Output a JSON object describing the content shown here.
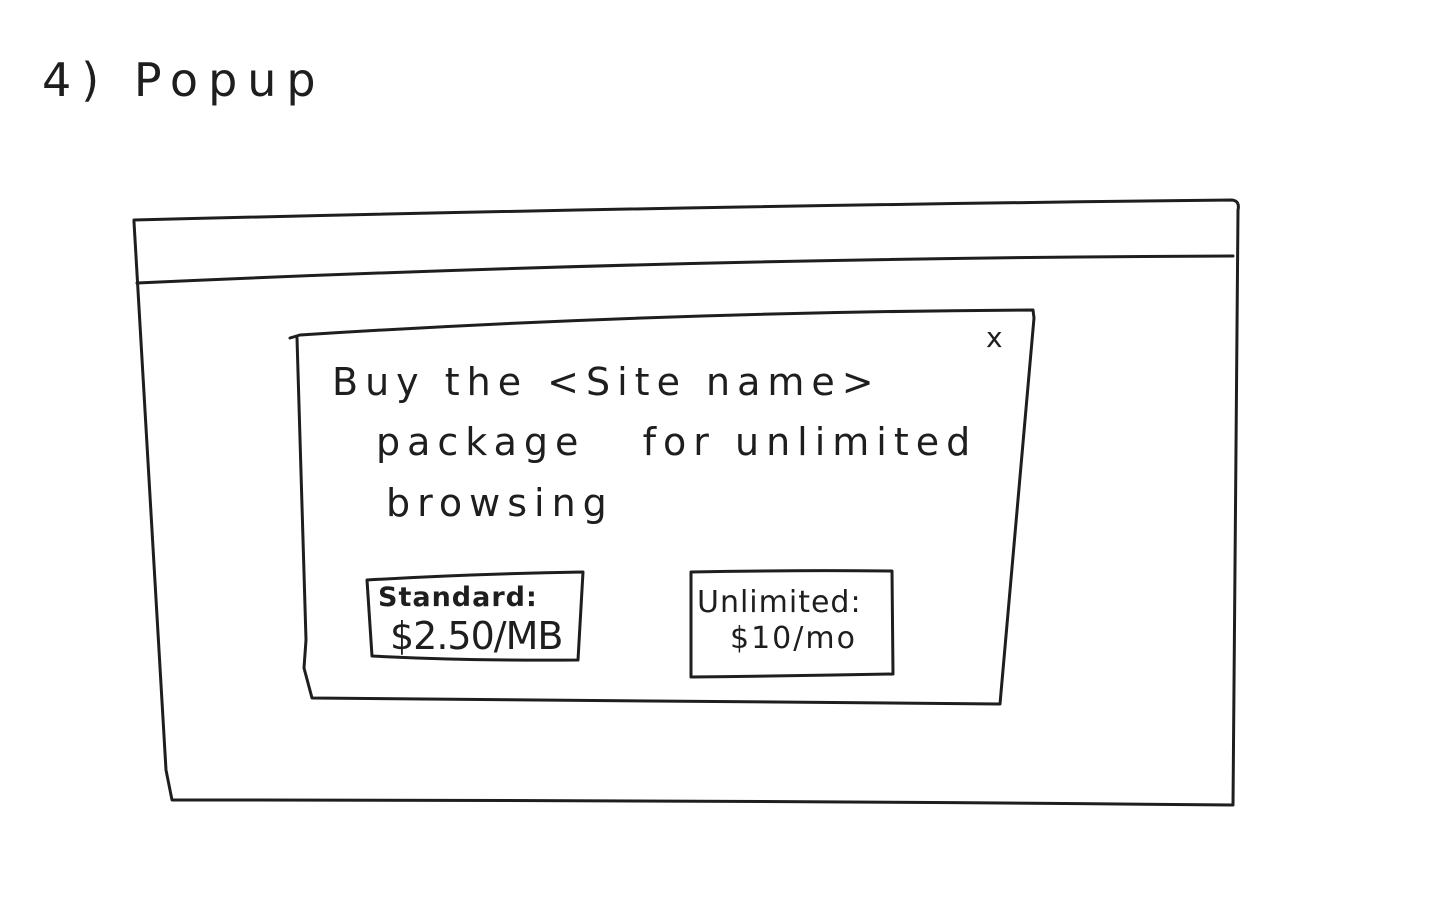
{
  "sketch": {
    "step_title": "4) Popup",
    "popup": {
      "close_label": "x",
      "message_lines": [
        "Buy the <Site name>",
        "package   for unlimited",
        "browsing"
      ],
      "options": [
        {
          "label": "Standard:",
          "price": "$2.50/MB"
        },
        {
          "label": "Unlimited:",
          "price": "$10/mo"
        }
      ]
    }
  }
}
